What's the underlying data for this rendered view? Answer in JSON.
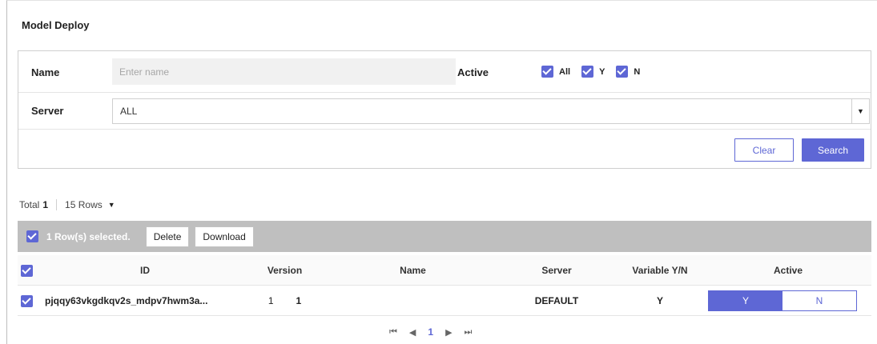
{
  "page": {
    "title": "Model Deploy"
  },
  "filter": {
    "name_label": "Name",
    "name_placeholder": "Enter name",
    "name_value": "",
    "active_label": "Active",
    "active_options": [
      {
        "label": "All",
        "checked": true
      },
      {
        "label": "Y",
        "checked": true
      },
      {
        "label": "N",
        "checked": true
      }
    ],
    "server_label": "Server",
    "server_value": "ALL",
    "clear_label": "Clear",
    "search_label": "Search"
  },
  "summary": {
    "total_label": "Total",
    "total_count": "1",
    "rows_label": "15 Rows"
  },
  "selection": {
    "text": "1 Row(s) selected.",
    "delete_label": "Delete",
    "download_label": "Download"
  },
  "table": {
    "columns": [
      "ID",
      "Version",
      "Name",
      "Server",
      "Variable Y/N",
      "Active"
    ],
    "rows": [
      {
        "checked": true,
        "id": "pjqqy63vkgdkqv2s_mdpv7hwm3a...",
        "version_a": "1",
        "version_b": "1",
        "name": "",
        "server": "DEFAULT",
        "variable": "Y",
        "active_y": "Y",
        "active_n": "N",
        "active_selected": "Y"
      }
    ]
  },
  "pagination": {
    "first": "⏮",
    "prev": "◀",
    "current": "1",
    "next": "▶",
    "last": "⏭"
  },
  "colors": {
    "accent": "#5e67d5",
    "selection_bar": "#bfbfbf"
  }
}
